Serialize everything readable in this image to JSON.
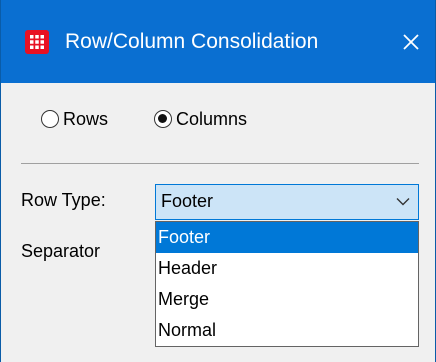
{
  "window": {
    "title": "Row/Column Consolidation",
    "app_icon": "app-grid-icon",
    "close_icon": "close-icon",
    "title_bar_color": "#0a6fd1"
  },
  "mode": {
    "options": [
      {
        "label": "Rows",
        "checked": false
      },
      {
        "label": "Columns",
        "checked": true
      }
    ]
  },
  "row_type": {
    "label": "Row Type:",
    "value": "Footer",
    "dropdown_open": true,
    "options": [
      "Footer",
      "Header",
      "Merge",
      "Normal"
    ],
    "highlighted": "Footer"
  },
  "separator": {
    "label": "Separator"
  },
  "colors": {
    "accent": "#0078d7",
    "select_bg": "#cce4f7"
  }
}
